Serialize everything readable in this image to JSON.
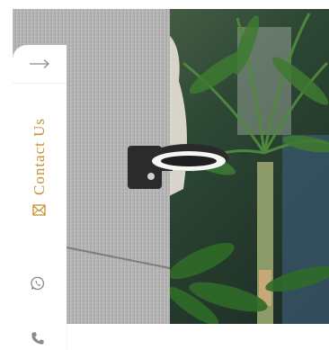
{
  "contact_rail": {
    "label": "Contact Us",
    "accent_color": "#c9902e",
    "icon_color": "#8a8a8a",
    "icons": [
      "arrow-right-icon",
      "mail-icon",
      "whatsapp-icon",
      "phone-icon"
    ]
  }
}
